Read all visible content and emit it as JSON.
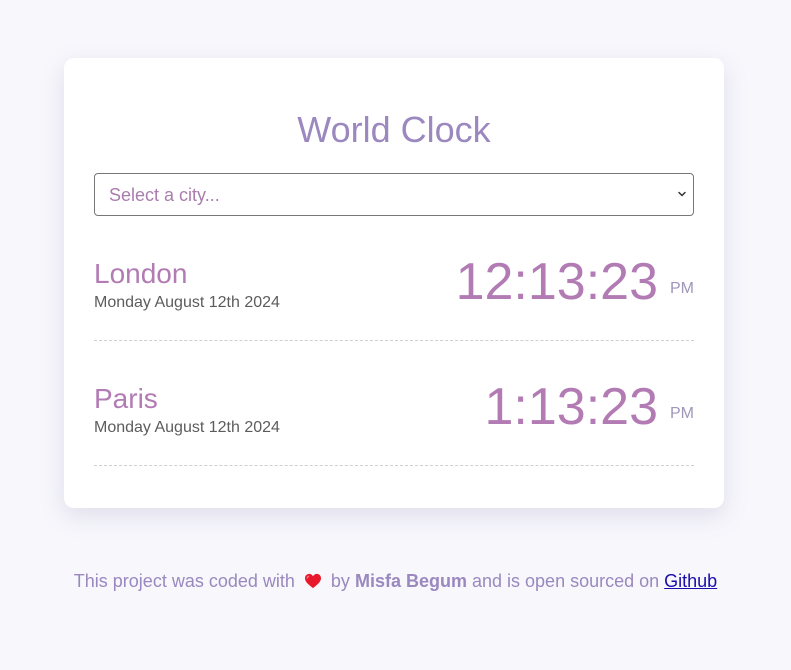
{
  "app": {
    "title": "World Clock"
  },
  "city_select": {
    "placeholder": "Select a city..."
  },
  "cities": [
    {
      "name": "London",
      "date": "Monday August 12th 2024",
      "time": "12:13:23",
      "ampm": "PM"
    },
    {
      "name": "Paris",
      "date": "Monday August 12th 2024",
      "time": "1:13:23",
      "ampm": "PM"
    }
  ],
  "footer": {
    "text_before": "This project was coded with",
    "text_by": "by",
    "author": "Misfa Begum",
    "text_after": "and is open sourced on",
    "link_label": "Github",
    "heart_icon": "heart-icon"
  },
  "colors": {
    "accent": "#b27bb4",
    "title": "#9a88bf",
    "background": "#f7f7fc"
  }
}
